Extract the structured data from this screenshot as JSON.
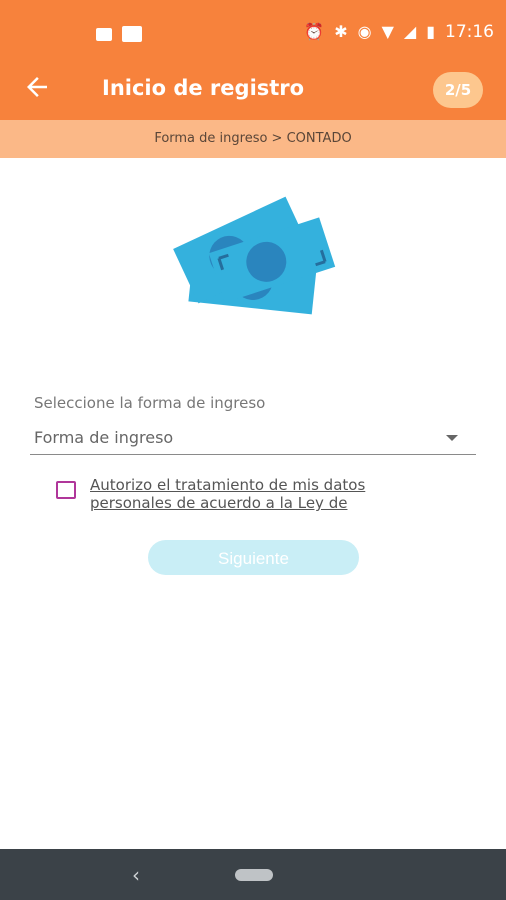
{
  "status_bar": {
    "time": "17:16",
    "icons": [
      "gallery-icon",
      "square-notification-icon",
      "alarm-icon",
      "bluetooth-icon",
      "vibrate-icon",
      "wifi-icon",
      "signal-icon",
      "battery-icon"
    ]
  },
  "app_bar": {
    "title": "Inicio de registro",
    "step": "2/5",
    "back_icon": "arrow-left-icon"
  },
  "breadcrumb": "Forma de ingreso > CONTADO",
  "illustration": {
    "name": "banknotes-icon",
    "color": "#29B6E0"
  },
  "form": {
    "label": "Seleccione la forma de ingreso",
    "select": {
      "placeholder": "Forma de ingreso"
    },
    "consent_text": "Autorizo el tratamiento de mis datos personales de acuerdo a la Ley de",
    "next_label": "Siguiente"
  },
  "colors": {
    "primary": "#F7823C",
    "breadcrumb_bg": "#FBB887",
    "checkbox": "#B0369A",
    "button_disabled": "#C9EEF6",
    "nav_bar": "#3B4248"
  }
}
